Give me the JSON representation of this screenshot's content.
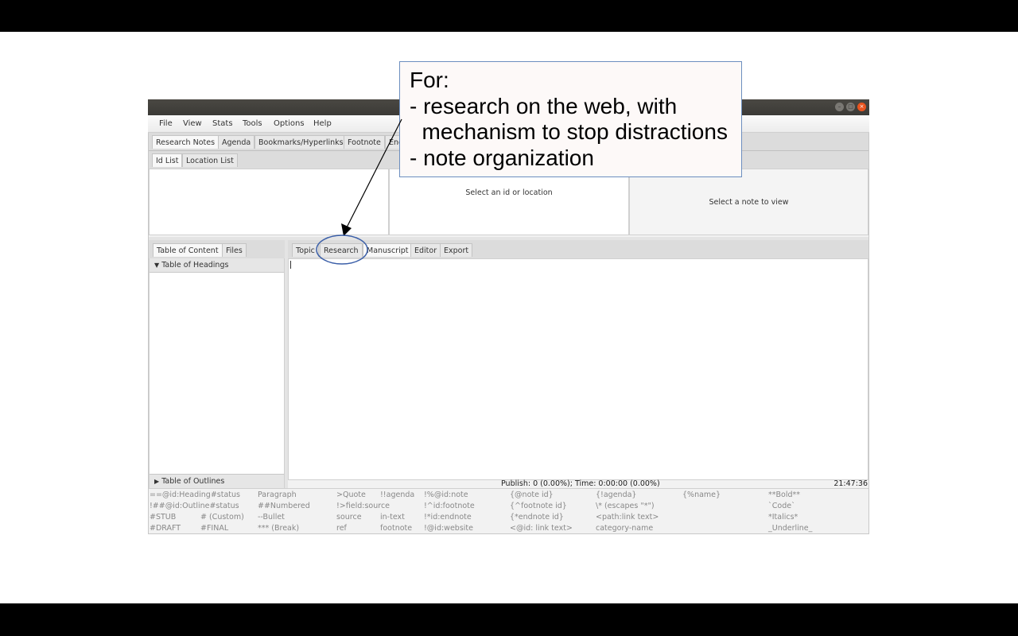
{
  "callout": {
    "line1": "For:",
    "line2": "- research on the web, with",
    "line3": "  mechanism to stop distractions",
    "line4": "- note organization"
  },
  "menu": [
    "File",
    "View",
    "Stats",
    "Tools",
    "Options",
    "Help"
  ],
  "top_tabs": [
    "Research Notes",
    "Agenda",
    "Bookmarks/Hyperlinks",
    "Footnote",
    "End"
  ],
  "inner_tabs": [
    "Id List",
    "Location List"
  ],
  "middle_placeholder": "Select an id or location",
  "right_placeholder": "Select a note to view",
  "left_tabs": [
    "Table of Content",
    "Files"
  ],
  "headings_label": "Table of Headings",
  "outlines_label": "Table of Outlines",
  "editor_tabs": [
    "Topic",
    "Research",
    "Manuscript",
    "Editor",
    "Export"
  ],
  "status": {
    "publish": "Publish: 0 (0.00%); Time: 0:00:00 (0.00%)",
    "clock": "21:47:36"
  },
  "cheatsheet": [
    [
      "==@id:Heading#status",
      "",
      "Paragraph",
      ">Quote",
      "!!agenda",
      "!%@id:note",
      "{@note id}",
      "{!agenda}",
      "{%name}",
      "**Bold**"
    ],
    [
      "!##@id:Outline#status",
      "",
      "##Numbered",
      "!>field:source",
      "",
      "!^id:footnote",
      "{^footnote id}",
      "\\* (escapes \"*\")",
      "",
      "`Code`"
    ],
    [
      "#STUB",
      "# (Custom)",
      "--Bullet",
      "source",
      "in-text",
      "!*id:endnote",
      "{*endnote id}",
      "<path:link text>",
      "",
      "*Italics*"
    ],
    [
      "#DRAFT",
      "#FINAL",
      "*** (Break)",
      "ref",
      "footnote",
      "!@id:website",
      "<@id: link text>",
      "category-name",
      "",
      "_Underline_"
    ]
  ]
}
